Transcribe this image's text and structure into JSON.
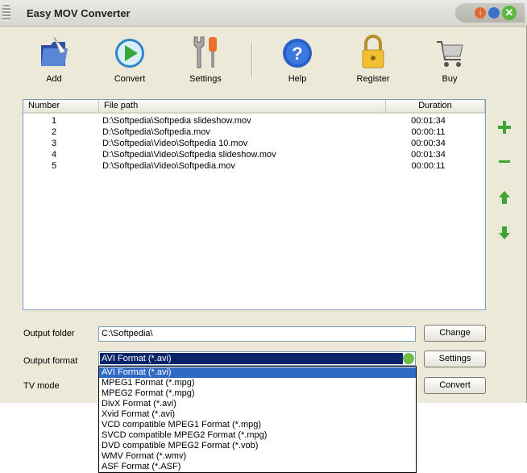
{
  "window": {
    "title": "Easy MOV Converter"
  },
  "toolbar": {
    "add_label": "Add",
    "convert_label": "Convert",
    "settings_label": "Settings",
    "help_label": "Help",
    "register_label": "Register",
    "buy_label": "Buy"
  },
  "file_list": {
    "columns": [
      "Number",
      "File path",
      "Duration"
    ],
    "rows": [
      {
        "number": "1",
        "path": "D:\\Softpedia\\Softpedia slideshow.mov",
        "duration": "00:01:34"
      },
      {
        "number": "2",
        "path": "D:\\Softpedia\\Softpedia.mov",
        "duration": "00:00:11"
      },
      {
        "number": "3",
        "path": "D:\\Softpedia\\Video\\Softpedia 10.mov",
        "duration": "00:00:34"
      },
      {
        "number": "4",
        "path": "D:\\Softpedia\\Video\\Softpedia slideshow.mov",
        "duration": "00:01:34"
      },
      {
        "number": "5",
        "path": "D:\\Softpedia\\Video\\Softpedia.mov",
        "duration": "00:00:11"
      }
    ]
  },
  "side_buttons": [
    "plus-icon",
    "minus-icon",
    "arrow-up-icon",
    "arrow-down-icon"
  ],
  "output": {
    "folder_label": "Output folder",
    "folder_value": "C:\\Softpedia\\",
    "change_label": "Change",
    "format_label": "Output format",
    "format_value": "AVI Format (*.avi)",
    "settings_label": "Settings",
    "tv_label": "TV mode",
    "convert_label": "Convert"
  },
  "format_options": [
    "AVI Format (*.avi)",
    "MPEG1 Format (*.mpg)",
    "MPEG2 Format (*.mpg)",
    "DivX Format (*.avi)",
    "Xvid Format (*.avi)",
    "VCD compatible MPEG1 Format (*.mpg)",
    "SVCD compatible MPEG2 Format (*.mpg)",
    "DVD compatible MPEG2 Format (*.vob)",
    "WMV Format (*.wmv)",
    "ASF Format (*.ASF)"
  ],
  "colors": {
    "window_bg": "#ece9d8",
    "selection": "#316ac5",
    "combo_selection": "#0a246a",
    "accent_green": "#3ea534"
  }
}
